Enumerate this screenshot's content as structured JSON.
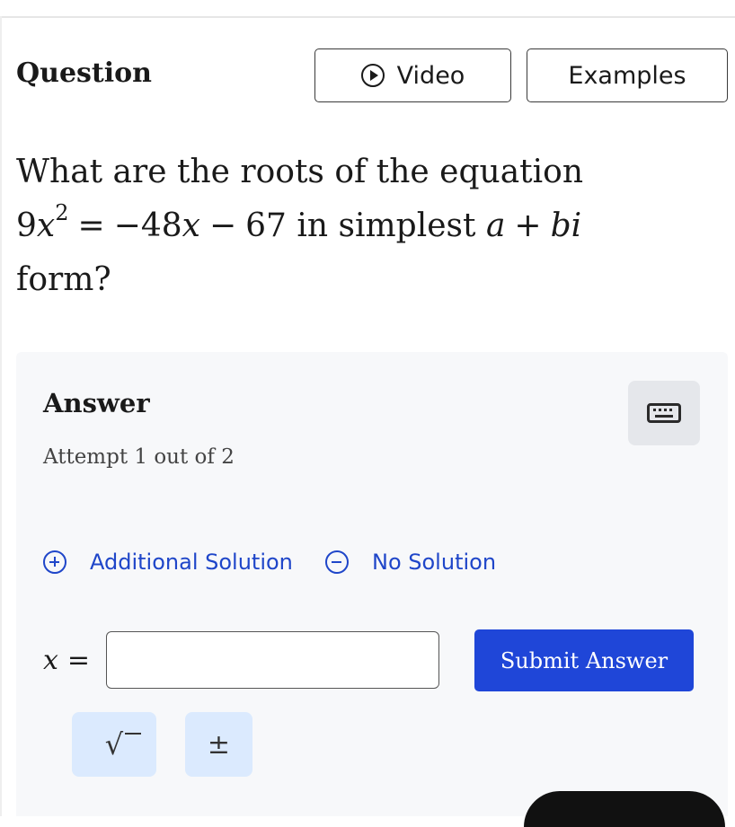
{
  "header": {
    "title": "Question",
    "video_label": "Video",
    "examples_label": "Examples"
  },
  "question": {
    "text_before": "What are the roots of the equation",
    "eq_coef": "9",
    "eq_var": "x",
    "eq_exp": "2",
    "eq_equals": "=",
    "eq_rhs_a": "−48",
    "eq_rhs_var": "x",
    "eq_minus": "−",
    "eq_rhs_b": "67",
    "text_middle": "in simplest",
    "form_a": "a",
    "form_plus": "+",
    "form_b": "b",
    "form_i": "i",
    "text_after": "form?"
  },
  "answer": {
    "title": "Answer",
    "attempt": "Attempt 1 out of 2",
    "additional_solution": "Additional Solution",
    "no_solution": "No Solution",
    "input_var": "x",
    "input_equals": "=",
    "input_value": "",
    "submit_label": "Submit Answer",
    "tool_sqrt": "√",
    "tool_pm": "±"
  },
  "colors": {
    "accent_blue": "#1f46d8",
    "link_blue": "#1f46c9",
    "tool_bg": "#dbeafe",
    "panel_bg": "#f7f8fa"
  },
  "icons": {
    "video": "play-circle-icon",
    "keyboard": "keyboard-icon",
    "add": "plus-circle-icon",
    "none": "minus-circle-icon"
  }
}
